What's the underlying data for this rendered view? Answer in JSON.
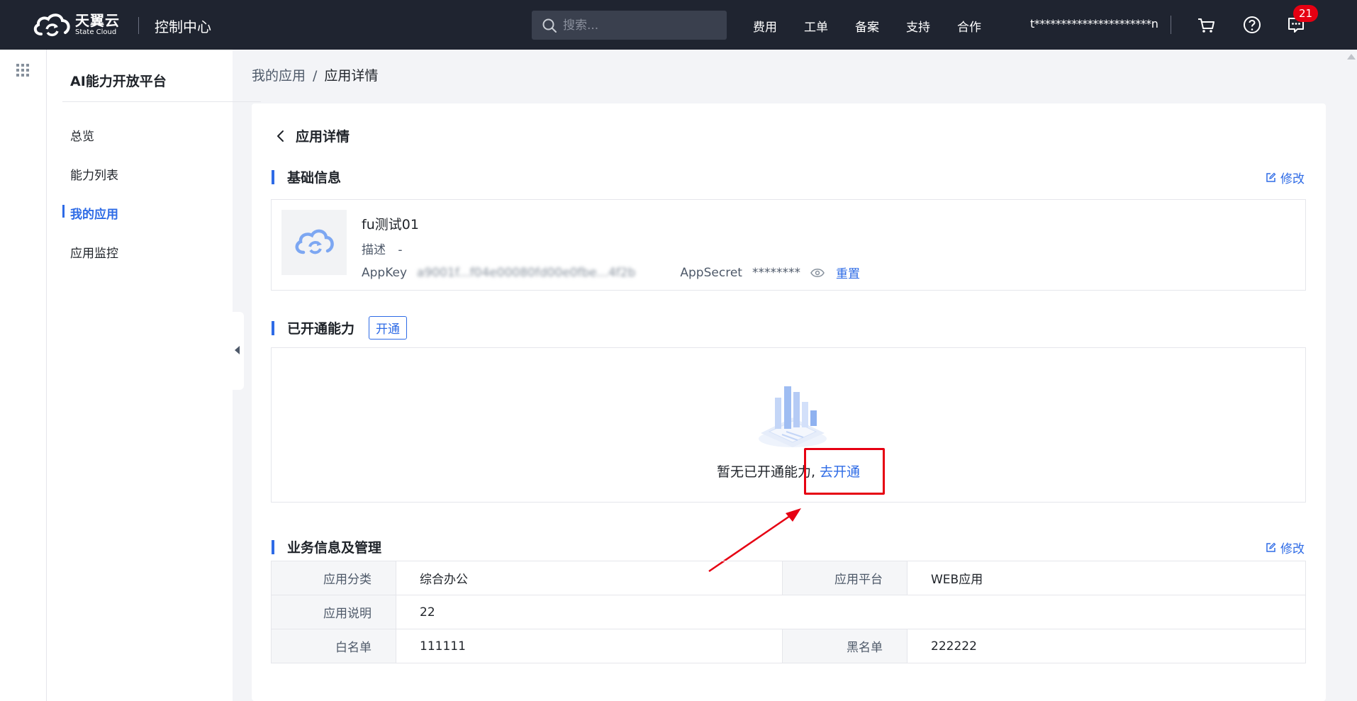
{
  "topbar": {
    "brand_cn": "天翼云",
    "brand_en": "State Cloud",
    "console_title": "控制中心",
    "search_placeholder": "搜索...",
    "nav": [
      "费用",
      "工单",
      "备案",
      "支持",
      "合作"
    ],
    "account": "t**********************n",
    "message_count": "21",
    "bg_color": "#1f2430"
  },
  "sidebar": {
    "title": "AI能力开放平台",
    "items": [
      "总览",
      "能力列表",
      "我的应用",
      "应用监控"
    ],
    "active_index": 2
  },
  "breadcrumb": {
    "parent": "我的应用",
    "separator": "/",
    "current": "应用详情"
  },
  "page": {
    "title": "应用详情",
    "basic_section": {
      "title": "基础信息",
      "edit_label": "修改",
      "app_name": "fu测试01",
      "desc_label": "描述",
      "desc_value": "-",
      "appkey_label": "AppKey",
      "appkey_value": "a9001f...f04e00080fd00e0fbe...4f2b",
      "appsecret_label": "AppSecret",
      "appsecret_value": "********",
      "reset_label": "重置"
    },
    "capability_section": {
      "title": "已开通能力",
      "open_button": "开通",
      "empty_text": "暂无已开通能力,",
      "empty_link": "去开通"
    },
    "business_section": {
      "title": "业务信息及管理",
      "edit_label": "修改",
      "rows": [
        {
          "label1": "应用分类",
          "value1": "综合办公",
          "label2": "应用平台",
          "value2": "WEB应用"
        },
        {
          "label1": "应用说明",
          "value1": "22"
        },
        {
          "label1": "白名单",
          "value1": "111111",
          "label2": "黑名单",
          "value2": "222222"
        }
      ]
    }
  },
  "accent_color": "#2e6be6",
  "highlight_color": "#e60012"
}
